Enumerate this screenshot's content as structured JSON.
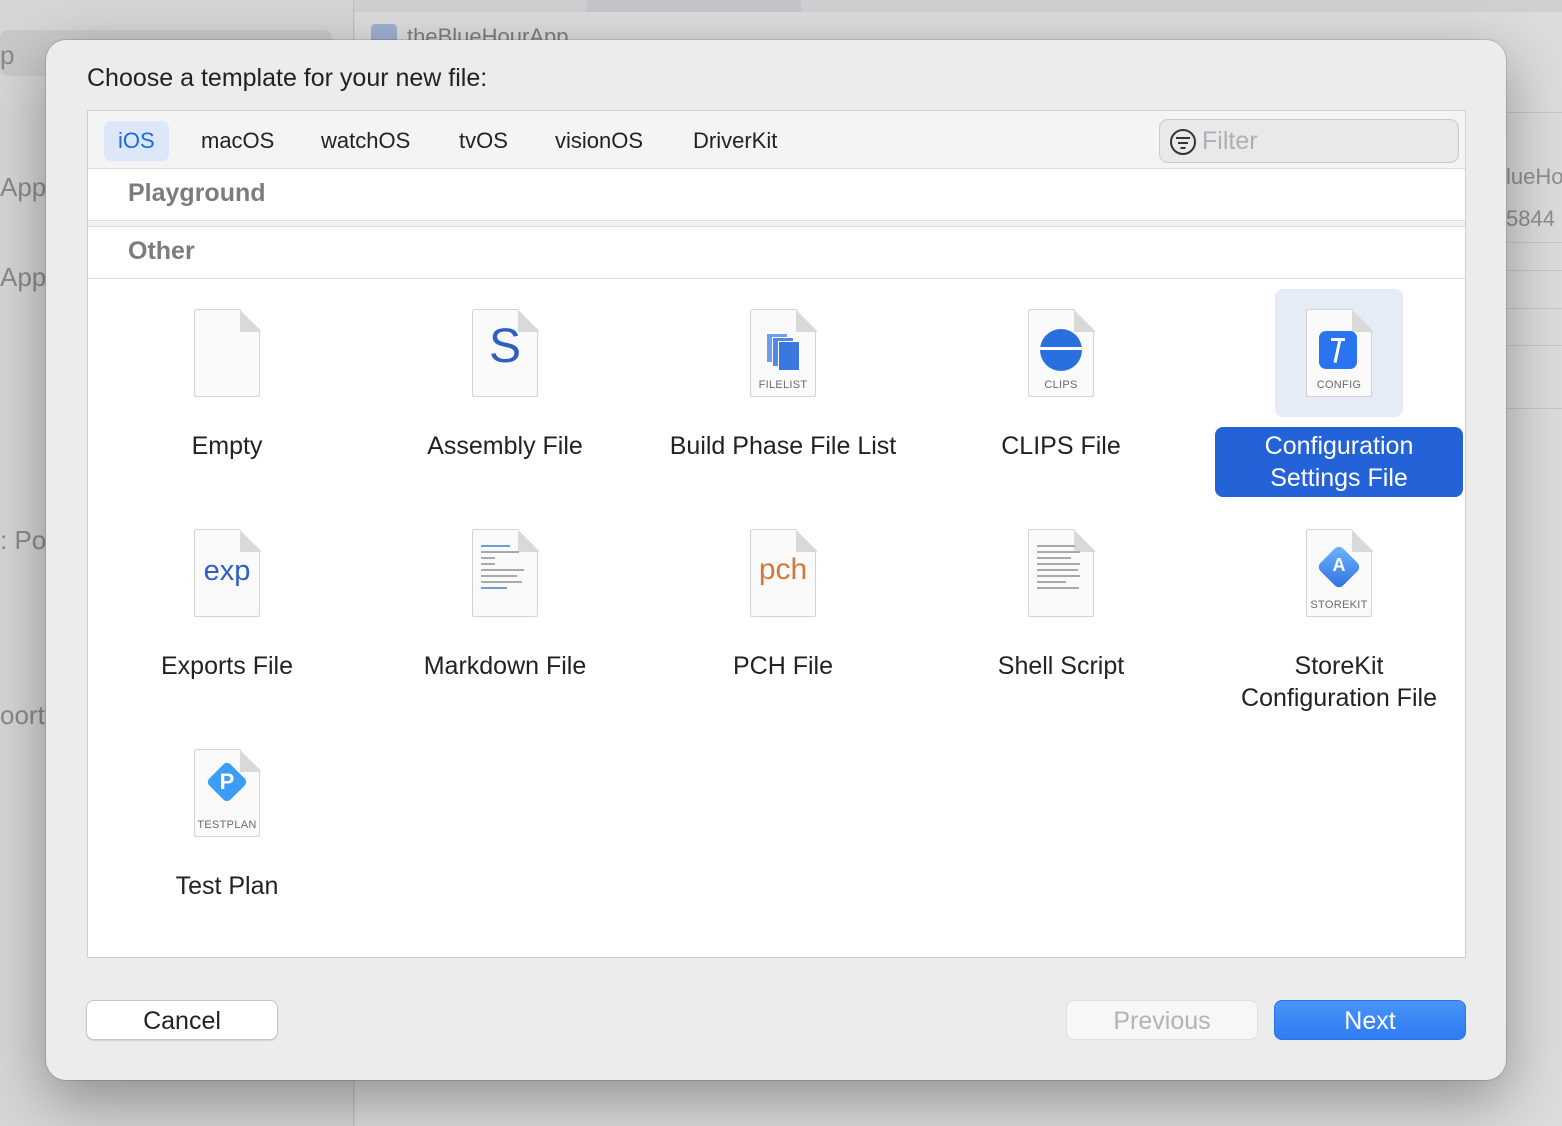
{
  "background": {
    "sidebar_fragments": [
      "p",
      "App",
      "AppT",
      ": Poc",
      "oort"
    ],
    "editor_title_fragment": "theBlueHourApp",
    "right_fragments": [
      "lueHo",
      "5844"
    ]
  },
  "dialog": {
    "title": "Choose a template for your new file:",
    "platforms": [
      {
        "label": "iOS",
        "active": true
      },
      {
        "label": "macOS",
        "active": false
      },
      {
        "label": "watchOS",
        "active": false
      },
      {
        "label": "tvOS",
        "active": false
      },
      {
        "label": "visionOS",
        "active": false
      },
      {
        "label": "DriverKit",
        "active": false
      }
    ],
    "filter": {
      "placeholder": "Filter",
      "value": ""
    },
    "sections": [
      "Playground",
      "Other"
    ],
    "templates": [
      {
        "label": "Empty",
        "icon": "empty-file-icon",
        "tag": "",
        "selected": false
      },
      {
        "label": "Assembly File",
        "icon": "assembly-s-icon",
        "glyph": "S",
        "tag": "",
        "selected": false
      },
      {
        "label": "Build Phase File List",
        "icon": "filelist-icon",
        "tag": "FILELIST",
        "selected": false
      },
      {
        "label": "CLIPS File",
        "icon": "clips-icon",
        "tag": "CLIPS",
        "selected": false
      },
      {
        "label": "Configuration Settings File",
        "icon": "config-icon",
        "tag": "CONFIG",
        "selected": true
      },
      {
        "label": "Exports File",
        "icon": "exports-icon",
        "glyph": "exp",
        "tag": "",
        "selected": false
      },
      {
        "label": "Markdown File",
        "icon": "markdown-icon",
        "tag": "",
        "selected": false
      },
      {
        "label": "PCH File",
        "icon": "pch-icon",
        "glyph": "pch",
        "tag": "",
        "selected": false
      },
      {
        "label": "Shell Script",
        "icon": "shell-script-icon",
        "tag": "",
        "selected": false
      },
      {
        "label": "StoreKit Configuration File",
        "icon": "storekit-icon",
        "tag": "STOREKIT",
        "selected": false
      },
      {
        "label": "Test Plan",
        "icon": "testplan-icon",
        "glyph": "P",
        "tag": "TESTPLAN",
        "selected": false
      }
    ],
    "buttons": {
      "cancel": "Cancel",
      "previous": "Previous",
      "next": "Next"
    },
    "colors": {
      "accent": "#2462d8",
      "next_button": "#3a86f5",
      "assembly": "#2f5fc4",
      "exports": "#2f5fc4",
      "pch": "#d3783a"
    }
  }
}
